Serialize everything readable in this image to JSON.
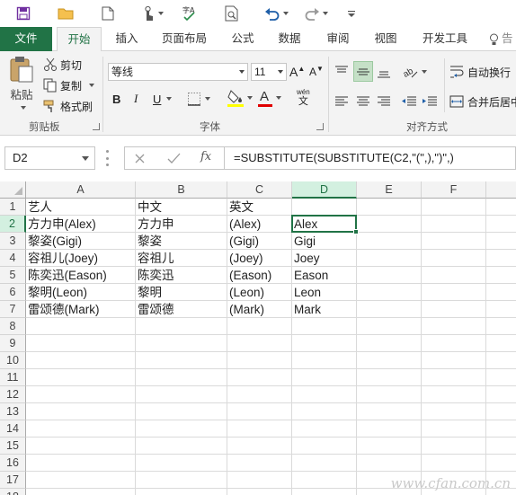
{
  "ribbon_tabs": [
    "文件",
    "开始",
    "插入",
    "页面布局",
    "公式",
    "数据",
    "审阅",
    "视图",
    "开发工具",
    "告"
  ],
  "clipboard": {
    "paste": "粘贴",
    "cut": "剪切",
    "copy": "复制",
    "format_painter": "格式刷",
    "group_label": "剪贴板"
  },
  "font": {
    "name": "等线",
    "size": "11",
    "bold": "B",
    "italic": "I",
    "underline": "U",
    "group_label": "字体",
    "grow": "A",
    "shrink": "A",
    "phonetic_top": "wén",
    "phonetic_bottom": "文"
  },
  "alignment": {
    "wrap_text": "自动换行",
    "merge_center": "合并后居中",
    "group_label": "对齐方式"
  },
  "name_box": "D2",
  "formula": "=SUBSTITUTE(SUBSTITUTE(C2,\"(\",),\")\",)",
  "columns": [
    "A",
    "B",
    "C",
    "D",
    "E",
    "F"
  ],
  "rows": [
    "1",
    "2",
    "3",
    "4",
    "5",
    "6",
    "7",
    "8",
    "9",
    "10",
    "11",
    "12",
    "13",
    "14",
    "15",
    "16",
    "17",
    "18"
  ],
  "cells": [
    [
      "艺人",
      "中文",
      "英文",
      ""
    ],
    [
      "方力申(Alex)",
      "方力申",
      "(Alex)",
      "Alex"
    ],
    [
      "黎姿(Gigi)",
      "黎姿",
      "(Gigi)",
      "Gigi"
    ],
    [
      "容祖儿(Joey)",
      "容祖儿",
      "(Joey)",
      "Joey"
    ],
    [
      "陈奕迅(Eason)",
      "陈奕迅",
      "(Eason)",
      "Eason"
    ],
    [
      "黎明(Leon)",
      "黎明",
      "(Leon)",
      "Leon"
    ],
    [
      "雷颂德(Mark)",
      "雷颂德",
      "(Mark)",
      "Mark"
    ]
  ],
  "colors": {
    "accent": "#217346",
    "selected_header_bg": "#d3f0e0"
  },
  "watermark": "www.cfan.com.cn"
}
